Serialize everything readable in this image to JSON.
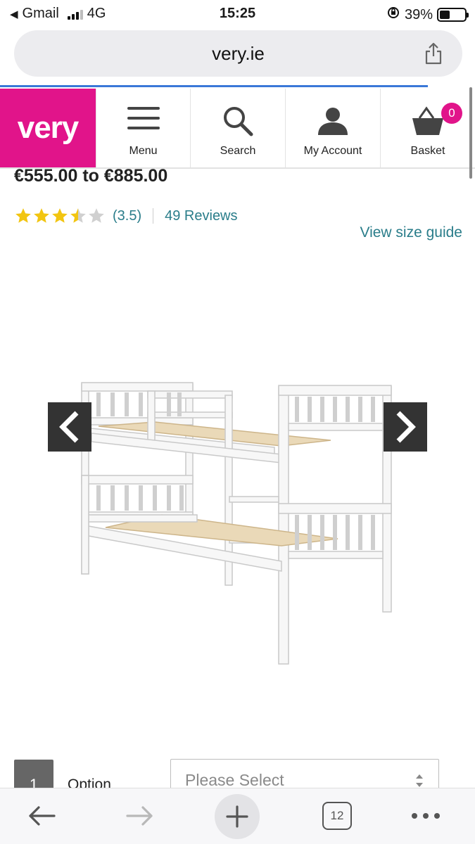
{
  "status_bar": {
    "back_app": "Gmail",
    "network": "4G",
    "time": "15:25",
    "battery": "39%"
  },
  "browser": {
    "url": "very.ie",
    "open_tabs": "12"
  },
  "site": {
    "logo": "very",
    "nav": {
      "menu": "Menu",
      "search": "Search",
      "account": "My Account",
      "basket": "Basket",
      "basket_count": "0"
    },
    "brand_color": "#e1148a"
  },
  "product": {
    "price": "€555.00 to €885.00",
    "rating_value": 3.5,
    "rating_text": "(3.5)",
    "reviews": "49 Reviews",
    "size_guide": "View size guide"
  },
  "option": {
    "number": "1",
    "label": "Option",
    "select_placeholder": "Please Select"
  }
}
